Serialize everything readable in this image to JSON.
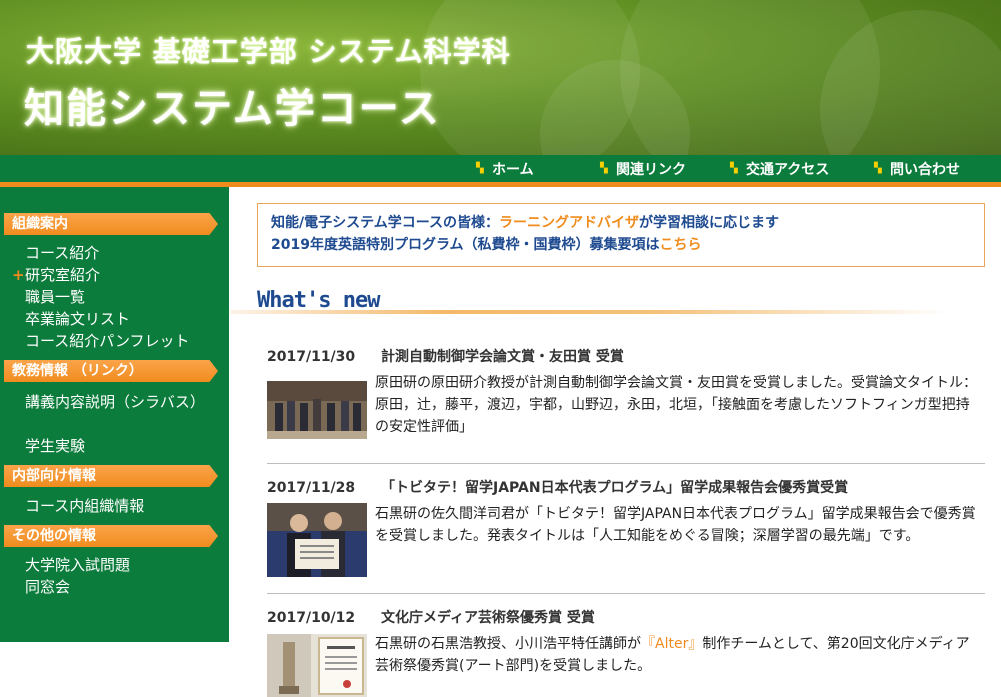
{
  "header": {
    "subtitle": "大阪大学 基礎工学部 システム科学科",
    "title": "知能システム学コース"
  },
  "nav": [
    {
      "label": "ホーム"
    },
    {
      "label": "関連リンク"
    },
    {
      "label": "交通アクセス"
    },
    {
      "label": "問い合わせ"
    }
  ],
  "sidebar": {
    "sections": [
      {
        "title": "組織案内",
        "items": [
          "コース紹介",
          "研究室紹介",
          "職員一覧",
          "卒業論文リスト",
          "コース紹介パンフレット"
        ]
      },
      {
        "title": "教務情報 （リンク）",
        "items": [
          "講義内容説明（シラバス）",
          "学生実験"
        ]
      },
      {
        "title": "内部向け情報",
        "items": [
          "コース内組織情報"
        ]
      },
      {
        "title": "その他の情報",
        "items": [
          "大学院入試問題",
          "同窓会"
        ]
      }
    ]
  },
  "notice": {
    "line1_prefix": "知能/電子システム学コースの皆様：",
    "line1_link": "ラーニングアドバイザ",
    "line1_suffix": "が学習相談に応じます",
    "line2_prefix": "2019年度英語特別プログラム（私費枠・国費枠）募集要項は",
    "line2_link": "こちら"
  },
  "whats_new_label": "What's new",
  "news": [
    {
      "date": "2017/11/30",
      "title": "計測自動制御学会論文賞・友田賞 受賞",
      "body": "原田研の原田研介教授が計測自動制御学会論文賞・友田賞を受賞しました。受賞論文タイトル：原田，辻，藤平，渡辺，宇都，山野辺，永田，北垣，「接触面を考慮したソフトフィンガ型把持の安定性評価」"
    },
    {
      "date": "2017/11/28",
      "title": "「トビタテ！留学JAPAN日本代表プログラム」留学成果報告会優秀賞受賞",
      "body": "石黒研の佐久間洋司君が「トビタテ！留学JAPAN日本代表プログラム」留学成果報告会で優秀賞を受賞しました。発表タイトルは「人工知能をめぐる冒険；深層学習の最先端」です。"
    },
    {
      "date": "2017/10/12",
      "title": "文化庁メディア芸術祭優秀賞 受賞",
      "body_prefix": "石黒研の石黒浩教授、小川浩平特任講師が",
      "body_link": "『Alter』",
      "body_suffix": "制作チームとして、第20回文化庁メディア芸術祭優秀賞(アート部門)を受賞しました。"
    }
  ]
}
